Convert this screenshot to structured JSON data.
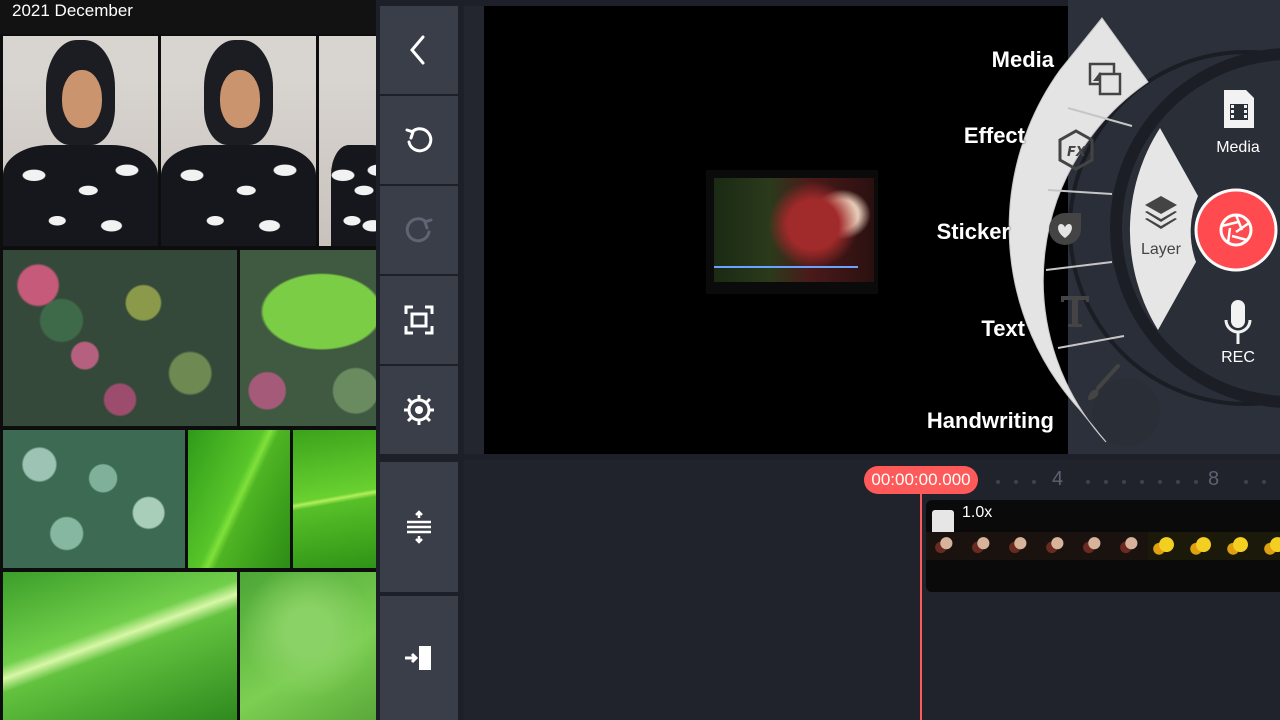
{
  "gallery": {
    "header": "2021 December"
  },
  "toolbar": {
    "items": [
      {
        "icon": "back-arrow-icon"
      },
      {
        "icon": "undo-icon"
      },
      {
        "icon": "redo-icon"
      },
      {
        "icon": "fullscreen-icon"
      },
      {
        "icon": "settings-gear-icon"
      }
    ],
    "timeline_items": [
      {
        "icon": "track-expand-icon"
      },
      {
        "icon": "jump-to-start-icon"
      }
    ]
  },
  "media_menu": {
    "items": [
      {
        "label": "Media",
        "icon": "media-image-icon"
      },
      {
        "label": "Effect",
        "icon": "fx-hexagon-icon"
      },
      {
        "label": "Sticker",
        "icon": "sticker-heart-icon"
      },
      {
        "label": "Text",
        "icon": "text-t-icon"
      },
      {
        "label": "Handwriting",
        "icon": "brush-icon"
      }
    ]
  },
  "wheel": {
    "media_label": "Media",
    "layer_label": "Layer",
    "rec_label": "REC"
  },
  "timeline": {
    "timecode": "00:00:00.000",
    "ruler_numbers": [
      "4",
      "8"
    ],
    "clip_speed": "1.0x"
  },
  "colors": {
    "accent_red": "#ff5a5a",
    "panel": "#3a3e49",
    "background": "#1d2028"
  }
}
